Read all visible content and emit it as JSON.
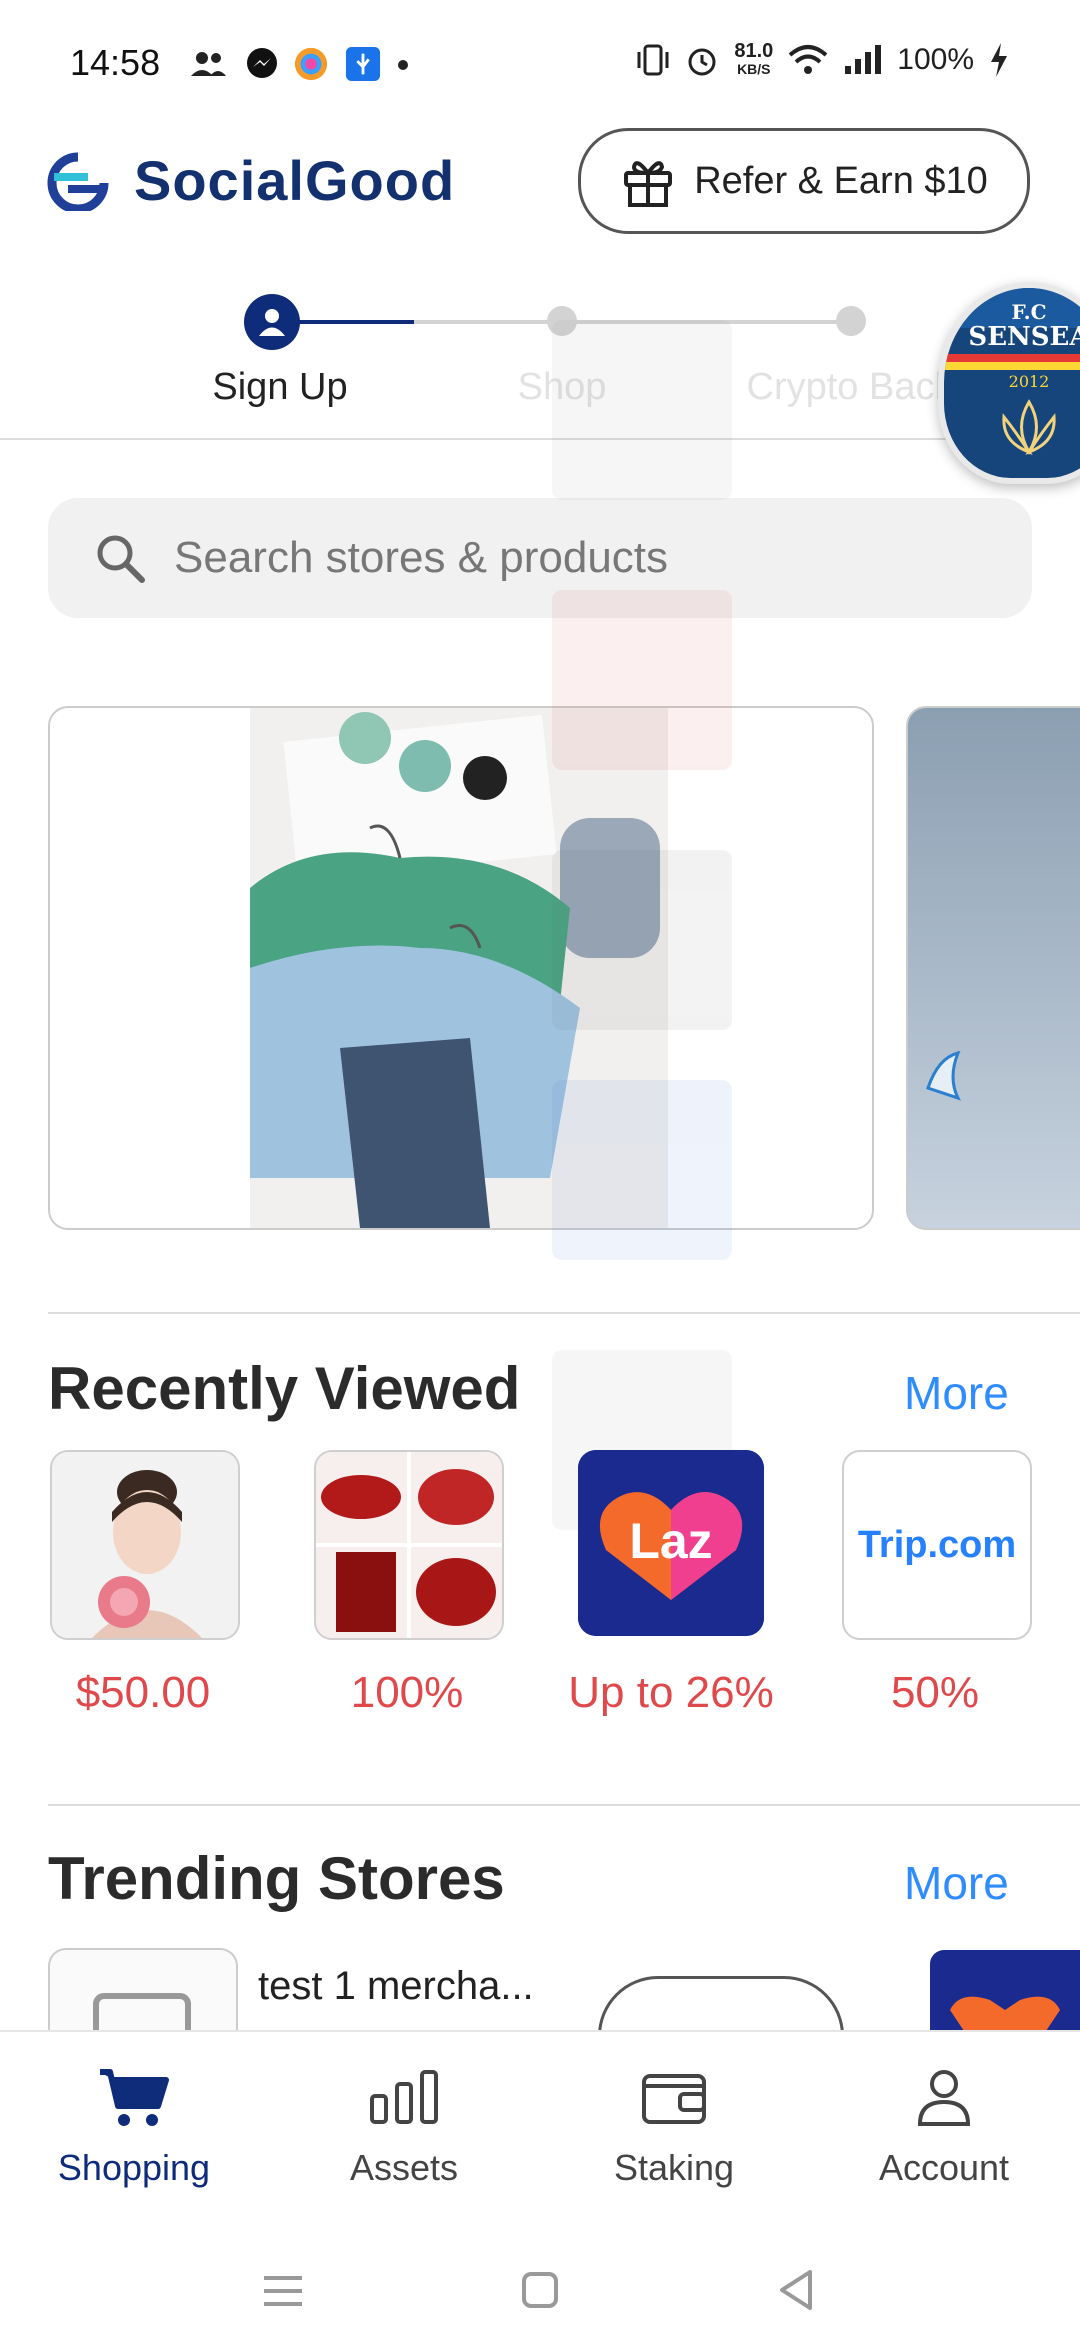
{
  "status_bar": {
    "time": "14:58",
    "net_speed": "81.0",
    "net_unit": "KB/S",
    "battery": "100%"
  },
  "header": {
    "brand": "SocialGood",
    "refer_label": "Refer & Earn $10"
  },
  "stepper": {
    "steps": [
      "Sign Up",
      "Shop",
      "Crypto Back"
    ]
  },
  "badge": {
    "line1": "F.C",
    "line2": "SENSEA",
    "year": "2012"
  },
  "search": {
    "placeholder": "Search stores & products"
  },
  "recently_viewed": {
    "title": "Recently Viewed",
    "more": "More",
    "items": [
      {
        "value": "$50.00",
        "icon": "portrait-image"
      },
      {
        "value": "100%",
        "icon": "lipstick-image"
      },
      {
        "value": "Up to 26%",
        "icon": "lazada-logo",
        "logo_text": "Laz"
      },
      {
        "value": "50%",
        "icon": "trip-logo",
        "logo_text": "Trip.com"
      }
    ]
  },
  "trending": {
    "title": "Trending Stores",
    "more": "More",
    "first_store": "test 1 mercha..."
  },
  "bottom_nav": {
    "items": [
      "Shopping",
      "Assets",
      "Staking",
      "Account"
    ],
    "active": "Shopping"
  },
  "colors": {
    "brand_navy": "#0e2c7a",
    "price_red": "#e0494b",
    "link_blue": "#2f8cff"
  }
}
